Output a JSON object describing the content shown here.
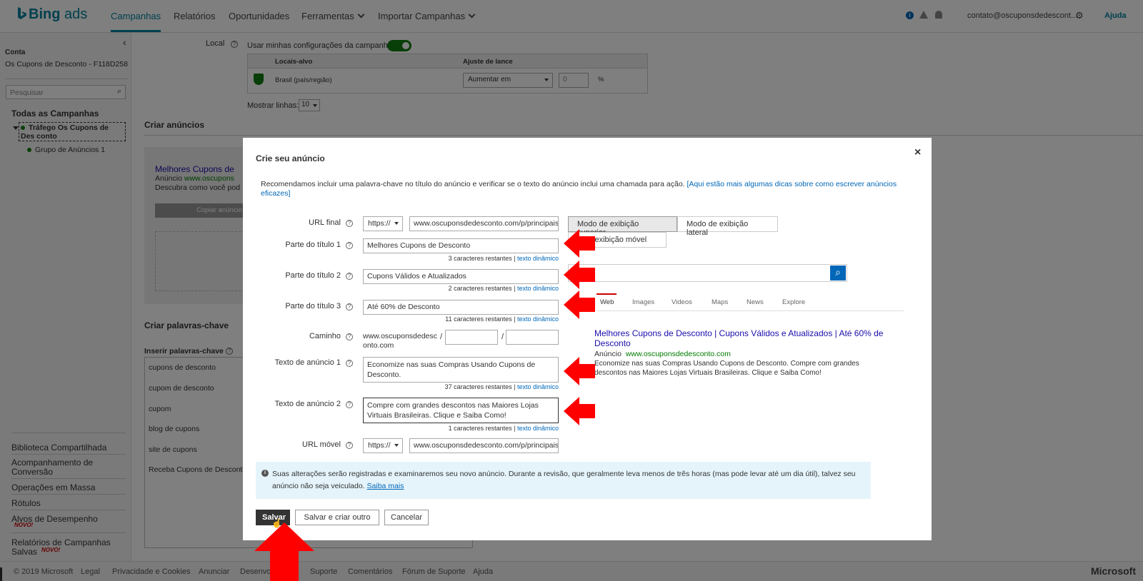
{
  "topbar": {
    "logo_prefix": "Bing",
    "logo_suffix": " ads",
    "nav": [
      "Campanhas",
      "Relatórios",
      "Oportunidades",
      "Ferramentas",
      "Importar Campanhas"
    ],
    "account_email": "contato@oscuponsdedescont...",
    "help": "Ajuda"
  },
  "sidebar": {
    "account_label": "Conta",
    "account_name": "Os Cupons de Desconto - F118D258",
    "search_placeholder": "Pesquisar",
    "all_campaigns": "Todas as Campanhas",
    "campaign": "Tráfego Os Cupons de Des conto",
    "ad_group": "Grupo de Anúncios 1",
    "links": [
      "Biblioteca Compartilhada",
      "Acompanhamento de Conversão",
      "Operações em Massa",
      "Rótulos",
      "Alvos de Desempenho",
      "Relatórios de Campanhas Salvas"
    ],
    "novo": "NOVO!"
  },
  "main": {
    "local_label": "Local",
    "use_settings": "Usar minhas configurações da campanha",
    "col_locais": "Locais-alvo",
    "col_ajuste": "Ajuste de lance",
    "location": "Brasil (país/região)",
    "bid_option": "Aumentar em",
    "bid_value": "0",
    "percent": "%",
    "show_rows": "Mostrar linhas:",
    "rows_value": "10",
    "create_ads": "Criar anúncios",
    "ad_preview_title": "Melhores Cupons de",
    "ad_preview_anuncio": "Anúncio",
    "ad_preview_url": "www.oscupons",
    "ad_preview_desc": "Descubra como você pod",
    "copy_ad": "Copiar anúncio",
    "create_keywords": "Criar palavras-chave",
    "insert_keywords": "Inserir palavras-chave",
    "keywords": [
      "cupons de desconto",
      "cupom de desconto",
      "cupom",
      "blog de cupons",
      "site de cupons",
      "Receba Cupons de Desconto"
    ]
  },
  "footer": {
    "links": [
      "© 2019 Microsoft",
      "Legal",
      "Privacidade e Cookies",
      "Anunciar",
      "Desenvo",
      "Suporte",
      "Comentários",
      "Fórum de Suporte",
      "Ajuda"
    ],
    "brand": "Microsoft"
  },
  "modal": {
    "title": "Crie seu anúncio",
    "close": "×",
    "intro": "Recomendamos incluir uma palavra-chave no título do anúncio e verificar se o texto do anúncio inclui uma chamada para ação.",
    "intro_link": "[Aqui estão mais algumas dicas sobre como escrever anúncios eficazes]",
    "labels": {
      "url_final": "URL final",
      "titulo1": "Parte do título 1",
      "titulo2": "Parte do título 2",
      "titulo3": "Parte do título 3",
      "caminho": "Caminho",
      "texto1": "Texto de anúncio 1",
      "texto2": "Texto de anúncio 2",
      "url_movel": "URL móvel"
    },
    "protocol": "https://",
    "url_final_value": "www.oscuponsdedesconto.com/p/principais",
    "titulo1_value": "Melhores Cupons de Desconto",
    "titulo2_value": "Cupons Válidos e Atualizados",
    "titulo3_value": "Até 60% de Desconto",
    "caminho_domain": "www.oscuponsdedesc onto.com",
    "slash": "/",
    "texto1_value": "Economize nas suas Compras Usando Cupons de Desconto.",
    "texto2_value": "Compre com grandes descontos nas Maiores Lojas Virtuais Brasileiras. Clique e Saiba Como!",
    "url_movel_value": "www.oscuponsdedesconto.com/p/principais",
    "counters": {
      "titulo1": "3 caracteres restantes |",
      "titulo2": "2 caracteres restantes |",
      "titulo3": "11 caracteres restantes |",
      "texto1": "37 caracteres restantes |",
      "texto2": "1 caracteres restantes |"
    },
    "dynamic_text": "texto dinâmico",
    "preview": {
      "tab_top": "Modo de exibição superior",
      "tab_side": "Modo de exibição lateral",
      "tab_mobile": "o de exibição móvel",
      "serp_tabs": [
        "Web",
        "Images",
        "Videos",
        "Maps",
        "News",
        "Explore"
      ],
      "ad_title": "Melhores Cupons de Desconto | Cupons Válidos e Atualizados | Até 60% de Desconto",
      "anuncio": "Anúncio",
      "ad_url": "www.oscuponsdedesconto.com",
      "ad_desc": "Economize nas suas Compras Usando Cupons de Desconto. Compre com grandes descontos nas Maiores Lojas Virtuais Brasileiras. Clique e Saiba Como!"
    },
    "notice": "Suas alterações serão registradas e examinaremos seu novo anúncio. Durante a revisão, que geralmente leva menos de três horas (mas pode levar até um dia útil), talvez seu anúncio não seja veiculado.",
    "notice_link": "Saiba mais",
    "buttons": {
      "save": "Salvar",
      "save_new": "Salvar e criar outro",
      "cancel": "Cancelar"
    }
  },
  "colors": {
    "brand": "#00809d",
    "accent_arrow": "#ff0000",
    "notice_bg": "#e5f4fb",
    "link": "#0067b8",
    "ad_title": "#1a0dab",
    "ad_url": "#007a00"
  }
}
